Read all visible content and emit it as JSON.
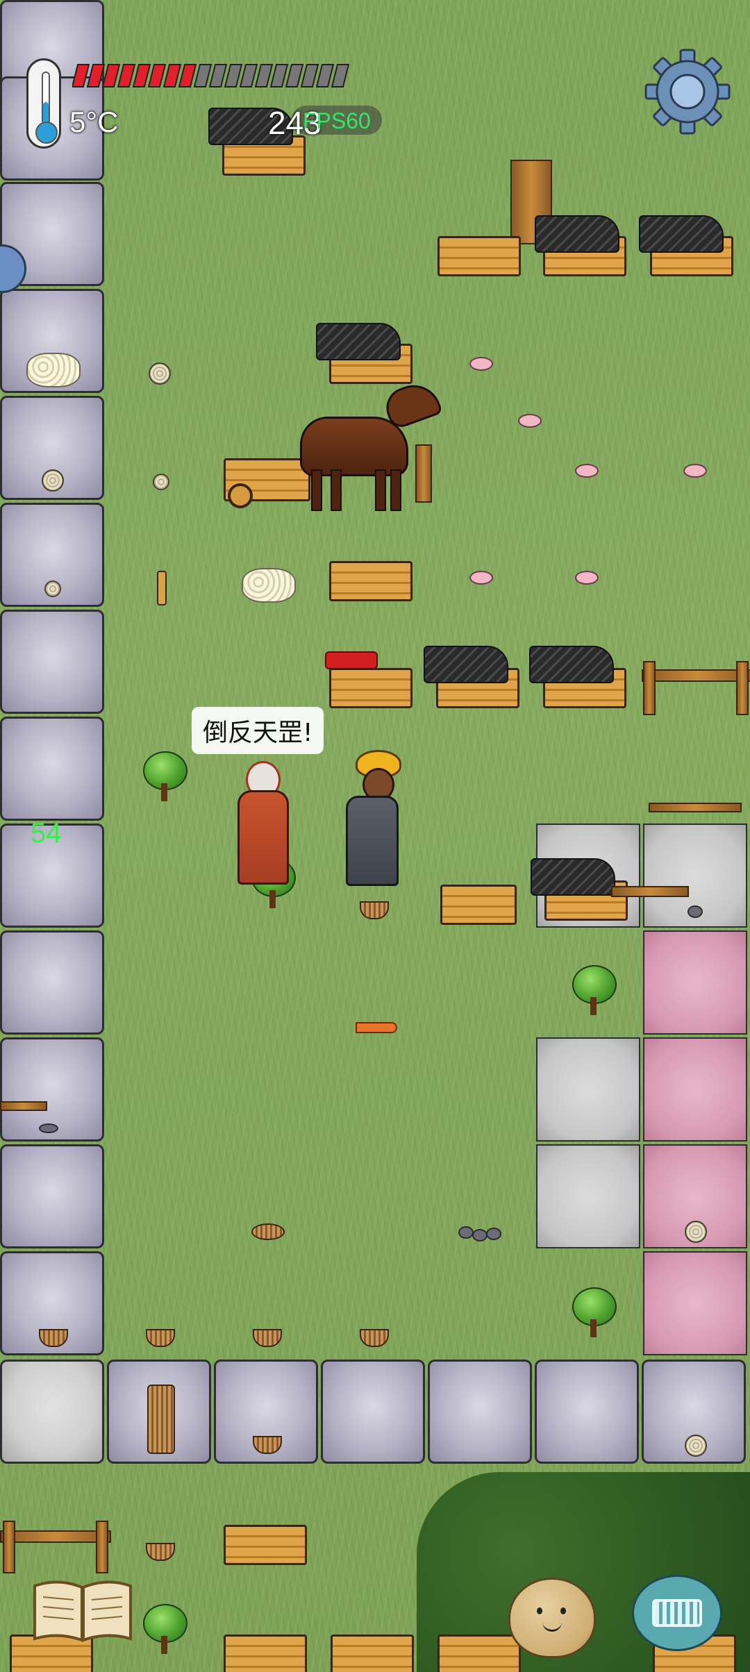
{
  "hud": {
    "temperature": "5°C",
    "food_count": "243",
    "fps": "FPS60",
    "age_counter": "54",
    "health_segments_total": 18,
    "health_segments_filled": 8
  },
  "speech": {
    "text": "倒反天罡!"
  },
  "icons": {
    "thermometer": "thermometer-icon",
    "settings": "gear-icon",
    "recipe_book": "book-icon",
    "emote": "potato-face-icon",
    "keyboard": "keyboard-icon"
  },
  "colors": {
    "health_fill": "#e0202a",
    "health_empty": "#777777",
    "fps_text": "#39e36b",
    "age_text": "#35f04a"
  }
}
